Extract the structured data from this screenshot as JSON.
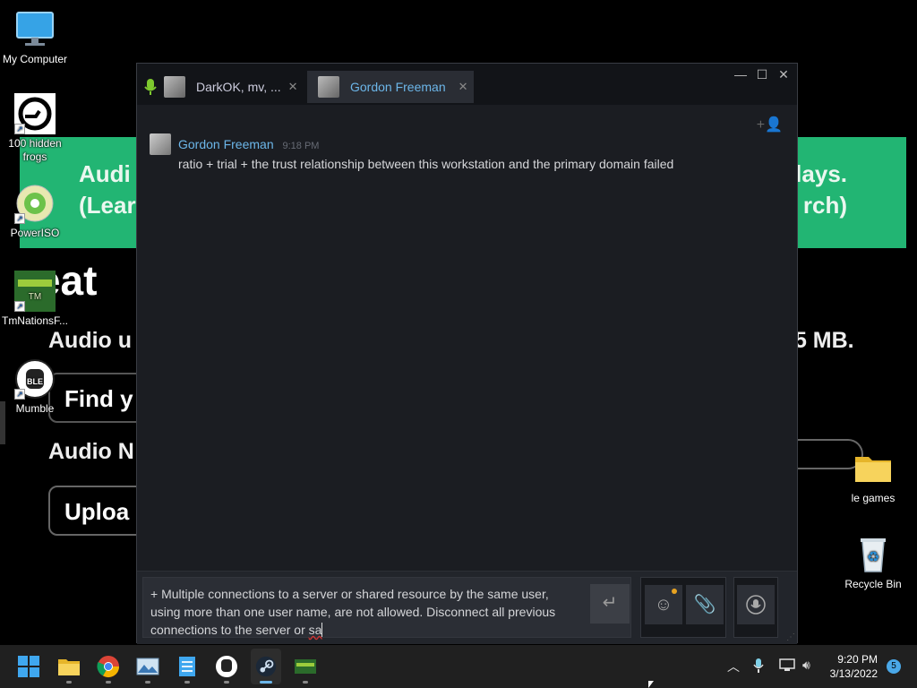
{
  "desktop": {
    "icons": [
      {
        "label": "My Computer",
        "icon": "monitor-icon"
      },
      {
        "label": "100 hidden frogs",
        "icon": "frog-game-icon"
      },
      {
        "label": "PowerISO",
        "icon": "disc-icon"
      },
      {
        "label": "TmNationsF...",
        "icon": "tmnations-icon"
      },
      {
        "label": "Mumble",
        "icon": "mumble-icon"
      },
      {
        "label": "le games",
        "icon": "folder-icon"
      },
      {
        "label": "Recycle Bin",
        "icon": "recycle-bin-icon"
      }
    ]
  },
  "background_page": {
    "banner_left_line1": "Audi",
    "banner_left_line2": "(Lear",
    "banner_right_line1": "lays.",
    "banner_right_line2": "rch)",
    "big_title": "reat",
    "line1_left": "Audio u",
    "line1_right": ".5 MB.",
    "find_button": "Find y",
    "line2": "Audio N",
    "upload_button": "Uploa"
  },
  "chat_window": {
    "tabs": [
      {
        "label": "DarkOK, mv, ..."
      },
      {
        "label": "Gordon Freeman"
      }
    ],
    "messages": [
      {
        "author": "Gordon Freeman",
        "time": "9:18 PM",
        "text": "ratio + trial + the trust relationship between this workstation and the primary domain failed"
      }
    ],
    "input": {
      "line1": "+ Multiple connections to a server or shared resource by the same user,",
      "line2": "using more than one user name, are not allowed. Disconnect all previous",
      "line3_prefix": "connections to the server or ",
      "line3_typo": "sa"
    },
    "colors": {
      "accent": "#6cb6e9",
      "background": "#1b1d22",
      "notification_dot": "#e8a321"
    }
  },
  "taskbar": {
    "apps": [
      "windows-start-icon",
      "file-explorer-icon",
      "chrome-icon",
      "photos-icon",
      "notepad-icon",
      "mumble-icon",
      "steam-icon",
      "tmnations-icon"
    ],
    "time": "9:20 PM",
    "date": "3/13/2022",
    "notification_count": "5"
  }
}
